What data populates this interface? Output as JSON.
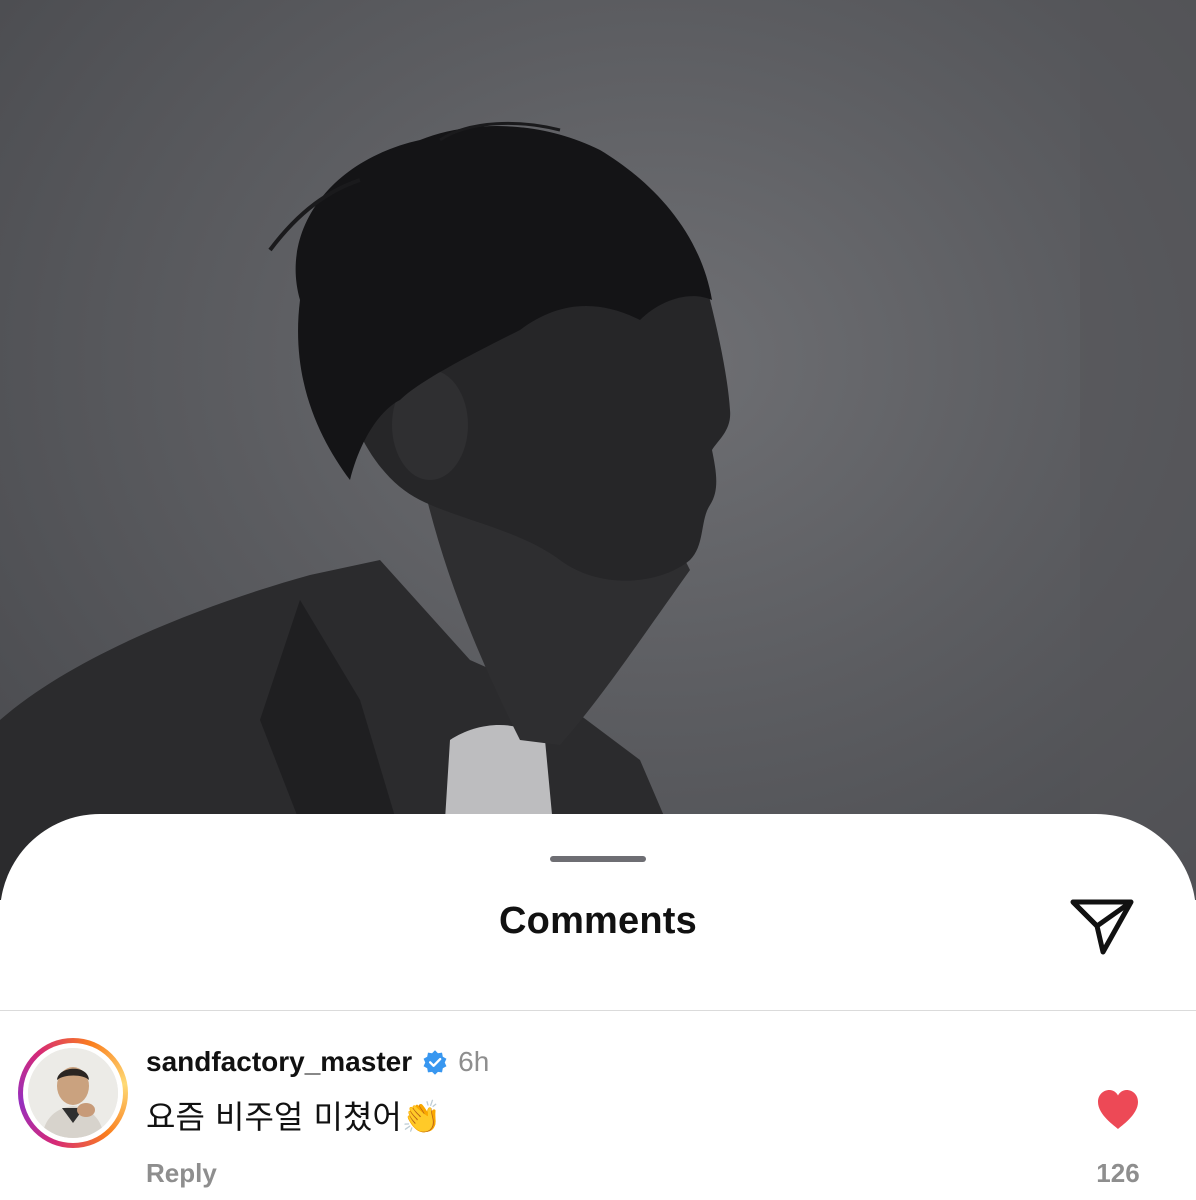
{
  "post": {
    "image_description_icon": "portrait-photo"
  },
  "sheet": {
    "title": "Comments",
    "share_icon": "send-icon"
  },
  "comment": {
    "username": "sandfactory_master",
    "verified": true,
    "timestamp": "6h",
    "text": "요즘 비주얼 미쳤어👏",
    "reply_label": "Reply",
    "like_count": "126",
    "liked": true
  },
  "colors": {
    "like": "#ed4956",
    "verified": "#3897f0",
    "muted_text": "#8e8e8e"
  }
}
